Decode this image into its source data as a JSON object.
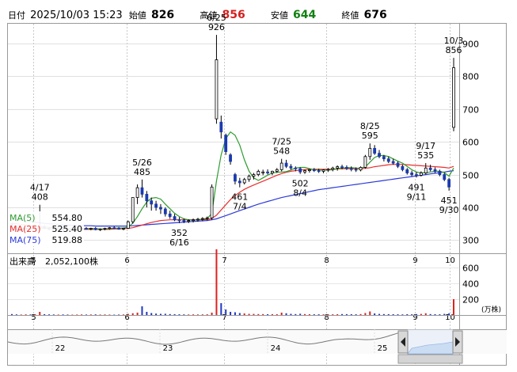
{
  "header": {
    "date_label": "日付",
    "datetime": "2025/10/03 15:23",
    "open_label": "始値",
    "open": "826",
    "high_label": "高値",
    "high": "856",
    "low_label": "安値",
    "low": "644",
    "close_label": "終値",
    "close": "676",
    "high_color": "#d42020",
    "low_color": "#108010"
  },
  "legend": {
    "ma5": "MA(5)",
    "ma5_value": "554.80",
    "ma25": "MA(25)",
    "ma25_value": "525.40",
    "ma75": "MA(75)",
    "ma75_value": "519.88",
    "ma5_color": "#2e9c2e",
    "ma25_color": "#e83030",
    "ma75_color": "#2b3ad8"
  },
  "volume_label": "出来高",
  "volume_value": "2,052,100株",
  "volume_unit": "(万株)",
  "navigator_labels": [
    "22",
    "23",
    "24",
    "25"
  ],
  "chart_data": [
    {
      "type": "candlestick",
      "x_ticks": [
        "5",
        "6",
        "7",
        "8",
        "9",
        "10"
      ],
      "y_ticks": [
        300,
        400,
        500,
        600,
        700,
        800,
        900
      ],
      "ylim": [
        260,
        960
      ],
      "grid": true,
      "candles": [
        [
          350,
          352,
          336,
          340
        ],
        [
          340,
          344,
          330,
          332
        ],
        [
          332,
          338,
          326,
          334
        ],
        [
          334,
          340,
          330,
          336
        ],
        [
          336,
          340,
          332,
          334
        ],
        [
          334,
          340,
          330,
          338
        ],
        [
          338,
          408,
          332,
          340
        ],
        [
          340,
          346,
          334,
          336
        ],
        [
          336,
          340,
          330,
          334
        ],
        [
          334,
          338,
          328,
          332
        ],
        [
          332,
          338,
          326,
          336
        ],
        [
          336,
          340,
          330,
          334
        ],
        [
          334,
          336,
          328,
          330
        ],
        [
          330,
          334,
          326,
          332
        ],
        [
          332,
          336,
          328,
          334
        ],
        [
          334,
          338,
          330,
          336
        ],
        [
          336,
          340,
          332,
          334
        ],
        [
          334,
          338,
          330,
          336
        ],
        [
          336,
          340,
          330,
          332
        ],
        [
          332,
          336,
          328,
          334
        ],
        [
          334,
          338,
          330,
          336
        ],
        [
          336,
          340,
          332,
          338
        ],
        [
          338,
          342,
          334,
          336
        ],
        [
          336,
          340,
          332,
          334
        ],
        [
          334,
          338,
          330,
          336
        ],
        [
          336,
          360,
          334,
          356
        ],
        [
          356,
          420,
          350,
          430
        ],
        [
          430,
          470,
          410,
          460
        ],
        [
          460,
          485,
          430,
          440
        ],
        [
          440,
          450,
          400,
          420
        ],
        [
          420,
          430,
          390,
          410
        ],
        [
          410,
          420,
          390,
          400
        ],
        [
          400,
          410,
          380,
          395
        ],
        [
          395,
          400,
          372,
          380
        ],
        [
          380,
          390,
          365,
          372
        ],
        [
          372,
          380,
          358,
          362
        ],
        [
          362,
          370,
          352,
          360
        ],
        [
          360,
          366,
          352,
          358
        ],
        [
          358,
          364,
          352,
          360
        ],
        [
          360,
          366,
          354,
          362
        ],
        [
          362,
          368,
          356,
          364
        ],
        [
          364,
          370,
          358,
          366
        ],
        [
          366,
          372,
          360,
          368
        ],
        [
          368,
          470,
          362,
          462
        ],
        [
          670,
          926,
          655,
          850
        ],
        [
          660,
          680,
          610,
          630
        ],
        [
          620,
          625,
          560,
          570
        ],
        [
          560,
          565,
          530,
          540
        ],
        [
          500,
          505,
          470,
          480
        ],
        [
          480,
          490,
          461,
          475
        ],
        [
          475,
          490,
          470,
          485
        ],
        [
          485,
          500,
          478,
          495
        ],
        [
          495,
          505,
          485,
          500
        ],
        [
          500,
          515,
          495,
          510
        ],
        [
          505,
          515,
          498,
          508
        ],
        [
          508,
          516,
          500,
          505
        ],
        [
          505,
          512,
          498,
          510
        ],
        [
          510,
          520,
          505,
          515
        ],
        [
          515,
          548,
          510,
          535
        ],
        [
          535,
          545,
          520,
          525
        ],
        [
          525,
          532,
          515,
          520
        ],
        [
          520,
          525,
          510,
          518
        ],
        [
          518,
          522,
          502,
          508
        ],
        [
          508,
          515,
          502,
          512
        ],
        [
          512,
          518,
          506,
          515
        ],
        [
          515,
          520,
          508,
          512
        ],
        [
          512,
          518,
          505,
          510
        ],
        [
          510,
          516,
          504,
          514
        ],
        [
          514,
          520,
          508,
          516
        ],
        [
          516,
          524,
          510,
          520
        ],
        [
          520,
          528,
          512,
          524
        ],
        [
          524,
          530,
          516,
          522
        ],
        [
          522,
          528,
          514,
          518
        ],
        [
          518,
          525,
          510,
          516
        ],
        [
          516,
          522,
          508,
          514
        ],
        [
          514,
          525,
          510,
          522
        ],
        [
          522,
          560,
          518,
          555
        ],
        [
          555,
          595,
          545,
          580
        ],
        [
          580,
          590,
          560,
          565
        ],
        [
          565,
          575,
          550,
          555
        ],
        [
          555,
          560,
          540,
          548
        ],
        [
          548,
          555,
          535,
          540
        ],
        [
          540,
          548,
          530,
          535
        ],
        [
          535,
          540,
          520,
          525
        ],
        [
          525,
          530,
          510,
          515
        ],
        [
          515,
          520,
          500,
          505
        ],
        [
          505,
          512,
          495,
          500
        ],
        [
          500,
          508,
          491,
          498
        ],
        [
          498,
          510,
          494,
          505
        ],
        [
          505,
          535,
          500,
          520
        ],
        [
          520,
          530,
          510,
          515
        ],
        [
          515,
          522,
          505,
          510
        ],
        [
          510,
          515,
          495,
          500
        ],
        [
          500,
          505,
          480,
          485
        ],
        [
          485,
          490,
          451,
          462
        ],
        [
          644,
          856,
          632,
          826
        ]
      ],
      "ma5": [
        340,
        337,
        336,
        335,
        335,
        336,
        337,
        336,
        335,
        334,
        334,
        333,
        332,
        332,
        333,
        334,
        335,
        335,
        335,
        334,
        334,
        335,
        336,
        337,
        337,
        340,
        352,
        372,
        396,
        416,
        428,
        430,
        425,
        410,
        396,
        382,
        372,
        365,
        362,
        361,
        362,
        364,
        366,
        382,
        480,
        560,
        610,
        630,
        620,
        590,
        545,
        510,
        490,
        482,
        490,
        498,
        505,
        507,
        508,
        509,
        514,
        520,
        522,
        522,
        518,
        515,
        514,
        514,
        514,
        515,
        518,
        520,
        521,
        521,
        520,
        519,
        523,
        538,
        552,
        558,
        558,
        555,
        548,
        541,
        535,
        525,
        515,
        508,
        505,
        506,
        508,
        510,
        510,
        506,
        495,
        520
      ],
      "ma25": [
        352,
        350,
        348,
        346,
        344,
        342,
        341,
        340,
        339,
        338,
        337,
        336,
        335,
        334,
        334,
        333,
        333,
        333,
        333,
        333,
        333,
        333,
        334,
        334,
        335,
        336,
        338,
        342,
        346,
        350,
        354,
        357,
        360,
        361,
        362,
        362,
        362,
        362,
        362,
        362,
        362,
        362,
        363,
        366,
        376,
        392,
        408,
        424,
        436,
        446,
        455,
        462,
        468,
        474,
        480,
        486,
        492,
        498,
        503,
        507,
        510,
        512,
        514,
        515,
        516,
        516,
        516,
        516,
        516,
        516,
        517,
        518,
        518,
        518,
        518,
        518,
        519,
        521,
        524,
        526,
        528,
        530,
        531,
        531,
        531,
        530,
        529,
        528,
        527,
        526,
        525,
        524,
        523,
        522,
        520,
        525
      ],
      "ma75": [
        365,
        363,
        361,
        359,
        357,
        355,
        353,
        351,
        350,
        349,
        348,
        347,
        346,
        345,
        345,
        344,
        344,
        344,
        343,
        343,
        343,
        343,
        343,
        343,
        343,
        343,
        344,
        345,
        346,
        347,
        348,
        349,
        350,
        351,
        352,
        353,
        354,
        355,
        356,
        357,
        358,
        359,
        360,
        362,
        365,
        370,
        375,
        380,
        385,
        390,
        395,
        400,
        405,
        410,
        414,
        418,
        422,
        426,
        430,
        433,
        436,
        439,
        442,
        445,
        448,
        451,
        454,
        456,
        458,
        460,
        462,
        464,
        466,
        468,
        470,
        472,
        474,
        476,
        478,
        480,
        482,
        484,
        486,
        488,
        490,
        492,
        494,
        496,
        498,
        500,
        502,
        504,
        506,
        508,
        510,
        512
      ],
      "annotations": [
        {
          "label": "4/17",
          "value": "408",
          "index": 6,
          "pos": "above"
        },
        {
          "label": "5/26",
          "value": "485",
          "index": 28,
          "pos": "above"
        },
        {
          "label": "352",
          "value": "6/16",
          "index": 36,
          "pos": "below"
        },
        {
          "label": "6/25",
          "value": "926",
          "index": 44,
          "pos": "above"
        },
        {
          "label": "461",
          "value": "7/4",
          "index": 49,
          "pos": "below"
        },
        {
          "label": "7/25",
          "value": "548",
          "index": 58,
          "pos": "above"
        },
        {
          "label": "502",
          "value": "8/4",
          "index": 62,
          "pos": "below"
        },
        {
          "label": "8/25",
          "value": "595",
          "index": 77,
          "pos": "above"
        },
        {
          "label": "491",
          "value": "9/11",
          "index": 87,
          "pos": "below"
        },
        {
          "label": "9/17",
          "value": "535",
          "index": 89,
          "pos": "above"
        },
        {
          "label": "451",
          "value": "9/30",
          "index": 94,
          "pos": "below"
        },
        {
          "label": "10/3",
          "value": "856",
          "index": 95,
          "pos": "above"
        }
      ]
    },
    {
      "type": "bar",
      "title": "出来高",
      "y_ticks": [
        200,
        400,
        600
      ],
      "ylim": [
        0,
        700
      ],
      "values": [
        12,
        8,
        6,
        8,
        7,
        9,
        40,
        10,
        8,
        7,
        6,
        7,
        6,
        5,
        6,
        7,
        6,
        7,
        8,
        6,
        7,
        6,
        5,
        6,
        7,
        14,
        22,
        30,
        110,
        40,
        25,
        18,
        15,
        16,
        12,
        10,
        9,
        8,
        7,
        8,
        7,
        8,
        9,
        30,
        830,
        150,
        70,
        40,
        35,
        25,
        20,
        15,
        14,
        12,
        12,
        10,
        11,
        10,
        30,
        22,
        15,
        12,
        16,
        12,
        10,
        9,
        9,
        8,
        10,
        9,
        10,
        12,
        11,
        10,
        9,
        12,
        25,
        45,
        20,
        14,
        12,
        11,
        10,
        9,
        8,
        10,
        9,
        12,
        14,
        22,
        12,
        10,
        9,
        14,
        20,
        200
      ],
      "up_color": "#e02020",
      "down_color": "#2038c8"
    },
    {
      "type": "area",
      "title": "navigator",
      "x_ticks": [
        "22",
        "23",
        "24",
        "25"
      ]
    }
  ]
}
